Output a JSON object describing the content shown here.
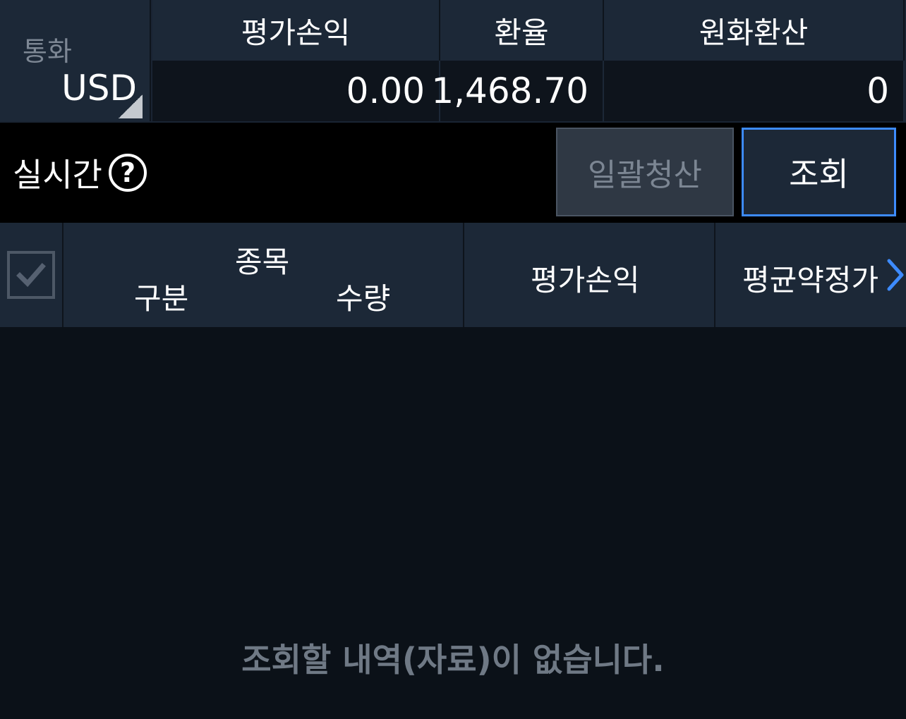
{
  "summary": {
    "currency_caption": "통화",
    "currency_value": "USD",
    "headers": [
      "평가손익",
      "환율",
      "원화환산"
    ],
    "values": [
      "0.00",
      "1,468.70",
      "0"
    ]
  },
  "realtime": {
    "label": "실시간",
    "help_glyph": "?"
  },
  "buttons": {
    "liquidate": "일괄청산",
    "query": "조회"
  },
  "table": {
    "header": {
      "item": "종목",
      "type": "구분",
      "quantity": "수량",
      "pnl": "평가손익",
      "avg_price": "평균약정가"
    },
    "empty_message": "조회할 내역(자료)이 없습니다."
  },
  "colors": {
    "accent": "#3d8bff",
    "header_bg": "#1c2837",
    "value_bg": "#0e141c",
    "body_bg": "#0b1118"
  },
  "icons": {
    "help": "help-circle-icon",
    "check": "checkmark-icon",
    "next": "chevron-right-icon",
    "dropdown": "dropdown-corner-icon"
  }
}
